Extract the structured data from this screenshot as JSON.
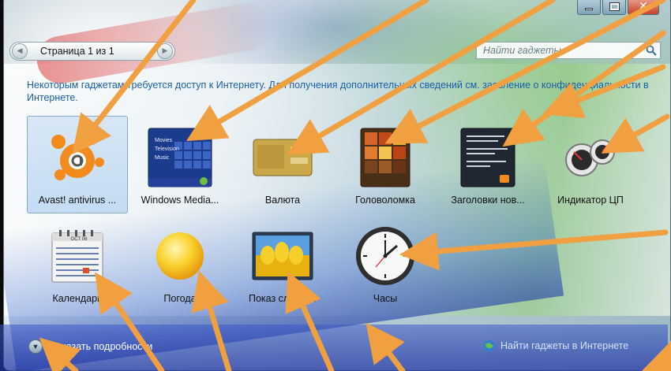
{
  "pager": {
    "label": "Страница 1 из 1"
  },
  "search": {
    "placeholder": "Найти гаджеты"
  },
  "notice": "Некоторым гаджетам требуется доступ к Интернету. Для получения дополнительных сведений см. заявление о конфиденциальности в Интернете.",
  "gadgets": [
    {
      "label": "Avast! antivirus ...",
      "icon": "avast-icon"
    },
    {
      "label": "Windows Media...",
      "icon": "windows-media-center-icon"
    },
    {
      "label": "Валюта",
      "icon": "currency-icon"
    },
    {
      "label": "Головоломка",
      "icon": "puzzle-icon"
    },
    {
      "label": "Заголовки нов...",
      "icon": "news-headlines-icon"
    },
    {
      "label": "Индикатор ЦП",
      "icon": "cpu-meter-icon"
    },
    {
      "label": "Календарь",
      "icon": "calendar-icon"
    },
    {
      "label": "Погода",
      "icon": "weather-sun-icon"
    },
    {
      "label": "Показ слайдов",
      "icon": "slideshow-icon"
    },
    {
      "label": "Часы",
      "icon": "clock-icon"
    }
  ],
  "wmc_text": [
    "Movies",
    "Television",
    "Music"
  ],
  "calendar_month": "OCT 06",
  "footer": {
    "details_label": "Показать подробности",
    "online_link": "Найти гаджеты в Интернете"
  },
  "colors": {
    "arrow": "#f0a040",
    "link": "#1a5fa8",
    "selection": "#b4d2f0"
  }
}
